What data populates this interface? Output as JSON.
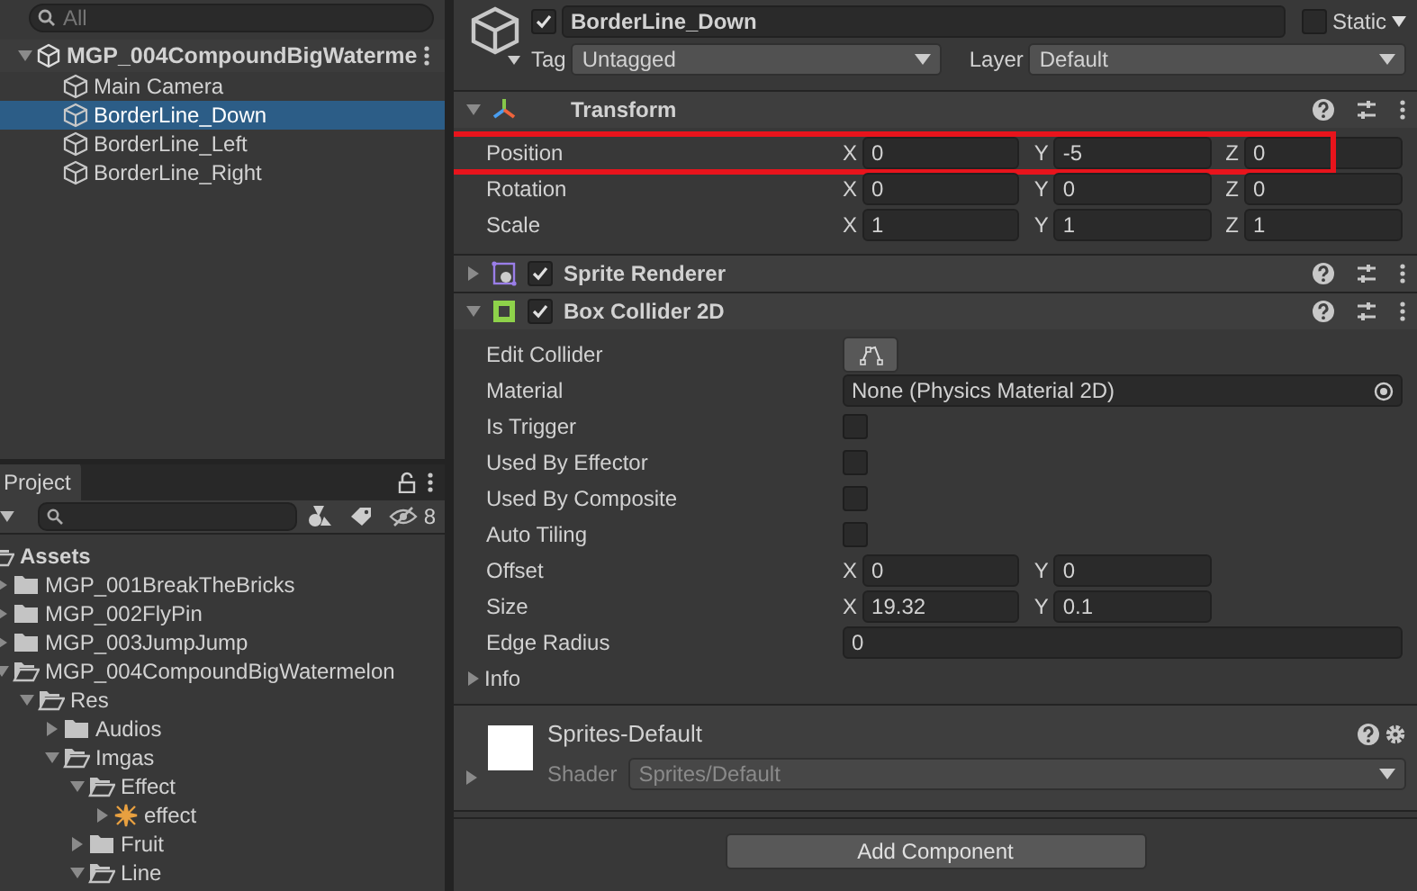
{
  "hierarchy": {
    "search": {
      "placeholder": "All"
    },
    "scene": {
      "label": "MGP_004CompoundBigWaterme",
      "expanded": true,
      "children": [
        {
          "label": "Main Camera",
          "selected": false
        },
        {
          "label": "BorderLine_Down",
          "selected": true
        },
        {
          "label": "BorderLine_Left",
          "selected": false
        },
        {
          "label": "BorderLine_Right",
          "selected": false
        }
      ]
    }
  },
  "project": {
    "tab": "Project",
    "hidden_count": "8",
    "tree": [
      {
        "label": "Assets",
        "kind": "root",
        "expanded": true,
        "children": [
          {
            "label": "MGP_001BreakTheBricks",
            "kind": "folder",
            "expanded": false
          },
          {
            "label": "MGP_002FlyPin",
            "kind": "folder",
            "expanded": false
          },
          {
            "label": "MGP_003JumpJump",
            "kind": "folder",
            "expanded": false
          },
          {
            "label": "MGP_004CompoundBigWatermelon",
            "kind": "folder",
            "expanded": true,
            "children": [
              {
                "label": "Res",
                "kind": "folder",
                "expanded": true,
                "children": [
                  {
                    "label": "Audios",
                    "kind": "folder",
                    "expanded": false
                  },
                  {
                    "label": "Imgas",
                    "kind": "folder",
                    "expanded": true,
                    "children": [
                      {
                        "label": "Effect",
                        "kind": "folder",
                        "expanded": true,
                        "children": [
                          {
                            "label": "effect",
                            "kind": "sprite",
                            "expanded": false
                          }
                        ]
                      },
                      {
                        "label": "Fruit",
                        "kind": "folder",
                        "expanded": false
                      },
                      {
                        "label": "Line",
                        "kind": "folder",
                        "expanded": true
                      }
                    ]
                  }
                ]
              }
            ]
          }
        ]
      }
    ]
  },
  "inspector": {
    "object": {
      "active": true,
      "name": "BorderLine_Down",
      "static": false,
      "static_label": "Static",
      "tag_label": "Tag",
      "tag": "Untagged",
      "layer_label": "Layer",
      "layer": "Default"
    },
    "components": [
      {
        "name": "Transform",
        "kind": "transform",
        "expanded": true,
        "rows": [
          {
            "label": "Position",
            "kind": "vector3",
            "highlighted": true,
            "fields": [
              {
                "axis": "X",
                "value": "0"
              },
              {
                "axis": "Y",
                "value": "-5"
              },
              {
                "axis": "Z",
                "value": "0"
              }
            ]
          },
          {
            "label": "Rotation",
            "kind": "vector3",
            "highlighted": false,
            "fields": [
              {
                "axis": "X",
                "value": "0"
              },
              {
                "axis": "Y",
                "value": "0"
              },
              {
                "axis": "Z",
                "value": "0"
              }
            ]
          },
          {
            "label": "Scale",
            "kind": "vector3",
            "highlighted": false,
            "fields": [
              {
                "axis": "X",
                "value": "1"
              },
              {
                "axis": "Y",
                "value": "1"
              },
              {
                "axis": "Z",
                "value": "1"
              }
            ]
          }
        ]
      },
      {
        "name": "Sprite Renderer",
        "kind": "sprite-renderer",
        "expanded": false,
        "enabled": true
      },
      {
        "name": "Box Collider 2D",
        "kind": "box-collider",
        "expanded": true,
        "enabled": true,
        "rows": [
          {
            "label": "Edit Collider",
            "kind": "button"
          },
          {
            "label": "Material",
            "kind": "object",
            "value": "None (Physics Material 2D)"
          },
          {
            "label": "Is Trigger",
            "kind": "checkbox",
            "checked": false
          },
          {
            "label": "Used By Effector",
            "kind": "checkbox",
            "checked": false
          },
          {
            "label": "Used By Composite",
            "kind": "checkbox",
            "checked": false
          },
          {
            "label": "Auto Tiling",
            "kind": "checkbox",
            "checked": false
          },
          {
            "label": "Offset",
            "kind": "vector2",
            "fields": [
              {
                "axis": "X",
                "value": "0"
              },
              {
                "axis": "Y",
                "value": "0"
              }
            ]
          },
          {
            "label": "Size",
            "kind": "vector2",
            "fields": [
              {
                "axis": "X",
                "value": "19.32"
              },
              {
                "axis": "Y",
                "value": "0.1"
              }
            ]
          },
          {
            "label": "Edge Radius",
            "kind": "float",
            "value": "0"
          },
          {
            "label": "Info",
            "kind": "foldout",
            "expanded": false
          }
        ]
      }
    ],
    "material": {
      "name": "Sprites-Default",
      "shader_label": "Shader",
      "shader": "Sprites/Default"
    },
    "add_button": "Add Component"
  }
}
